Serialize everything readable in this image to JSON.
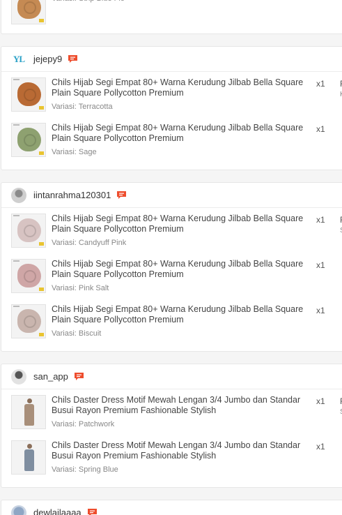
{
  "orders": [
    {
      "items": [
        {
          "variant": "Variasi: Strip Blue Flo",
          "thumb_color": "#c58a53"
        }
      ]
    },
    {
      "username": "jejepy9",
      "avatar": "logo",
      "avatar_text": "YL",
      "items": [
        {
          "title": "Chils Hijab Segi Empat 80+ Warna Kerudung Jilbab Bella Square Plain Square Pollycotton Premium",
          "variant": "Variasi: Terracotta",
          "qty": "x1",
          "right": "F",
          "right_sub": "K",
          "thumb_color": "#b96a34"
        },
        {
          "title": "Chils Hijab Segi Empat 80+ Warna Kerudung Jilbab Bella Square Plain Square Pollycotton Premium",
          "variant": "Variasi: Sage",
          "qty": "x1",
          "right": "",
          "right_sub": "",
          "thumb_color": "#8ea170"
        }
      ]
    },
    {
      "username": "iintanrahma120301",
      "avatar": "photo1",
      "items": [
        {
          "title": "Chils Hijab Segi Empat 80+ Warna Kerudung Jilbab Bella Square Plain Square Pollycotton Premium",
          "variant": "Variasi: Candyuff Pink",
          "qty": "x1",
          "right": "F",
          "right_sub": "S",
          "thumb_color": "#d7c3c2"
        },
        {
          "title": "Chils Hijab Segi Empat 80+ Warna Kerudung Jilbab Bella Square Plain Square Pollycotton Premium",
          "variant": "Variasi: Pink Salt",
          "qty": "x1",
          "right": "",
          "right_sub": "",
          "thumb_color": "#cfa6a6"
        },
        {
          "title": "Chils Hijab Segi Empat 80+ Warna Kerudung Jilbab Bella Square Plain Square Pollycotton Premium",
          "variant": "Variasi: Biscuit",
          "qty": "x1",
          "right": "",
          "right_sub": "",
          "thumb_color": "#c9b5ae"
        }
      ]
    },
    {
      "username": "san_app",
      "avatar": "photo2",
      "items": [
        {
          "title": "Chils Daster Dress Motif Mewah Lengan 3/4 Jumbo dan Standar Busui Rayon Premium Fashionable Stylish",
          "variant": "Variasi: Patchwork",
          "qty": "x1",
          "right": "F",
          "right_sub": "S",
          "thumb_color": "#a88f7a",
          "dress": true
        },
        {
          "title": "Chils Daster Dress Motif Mewah Lengan 3/4 Jumbo dan Standar Busui Rayon Premium Fashionable Stylish",
          "variant": "Variasi: Spring Blue",
          "qty": "x1",
          "right": "",
          "right_sub": "",
          "thumb_color": "#7f8ea0",
          "dress": true
        }
      ]
    },
    {
      "username": "dewlailaaaa",
      "avatar": "photo3",
      "items": []
    }
  ],
  "colors": {
    "chat_icon": "#ee4d2d",
    "text": "#444444",
    "muted": "#888888"
  },
  "icons": {
    "chat": "chat-icon"
  }
}
